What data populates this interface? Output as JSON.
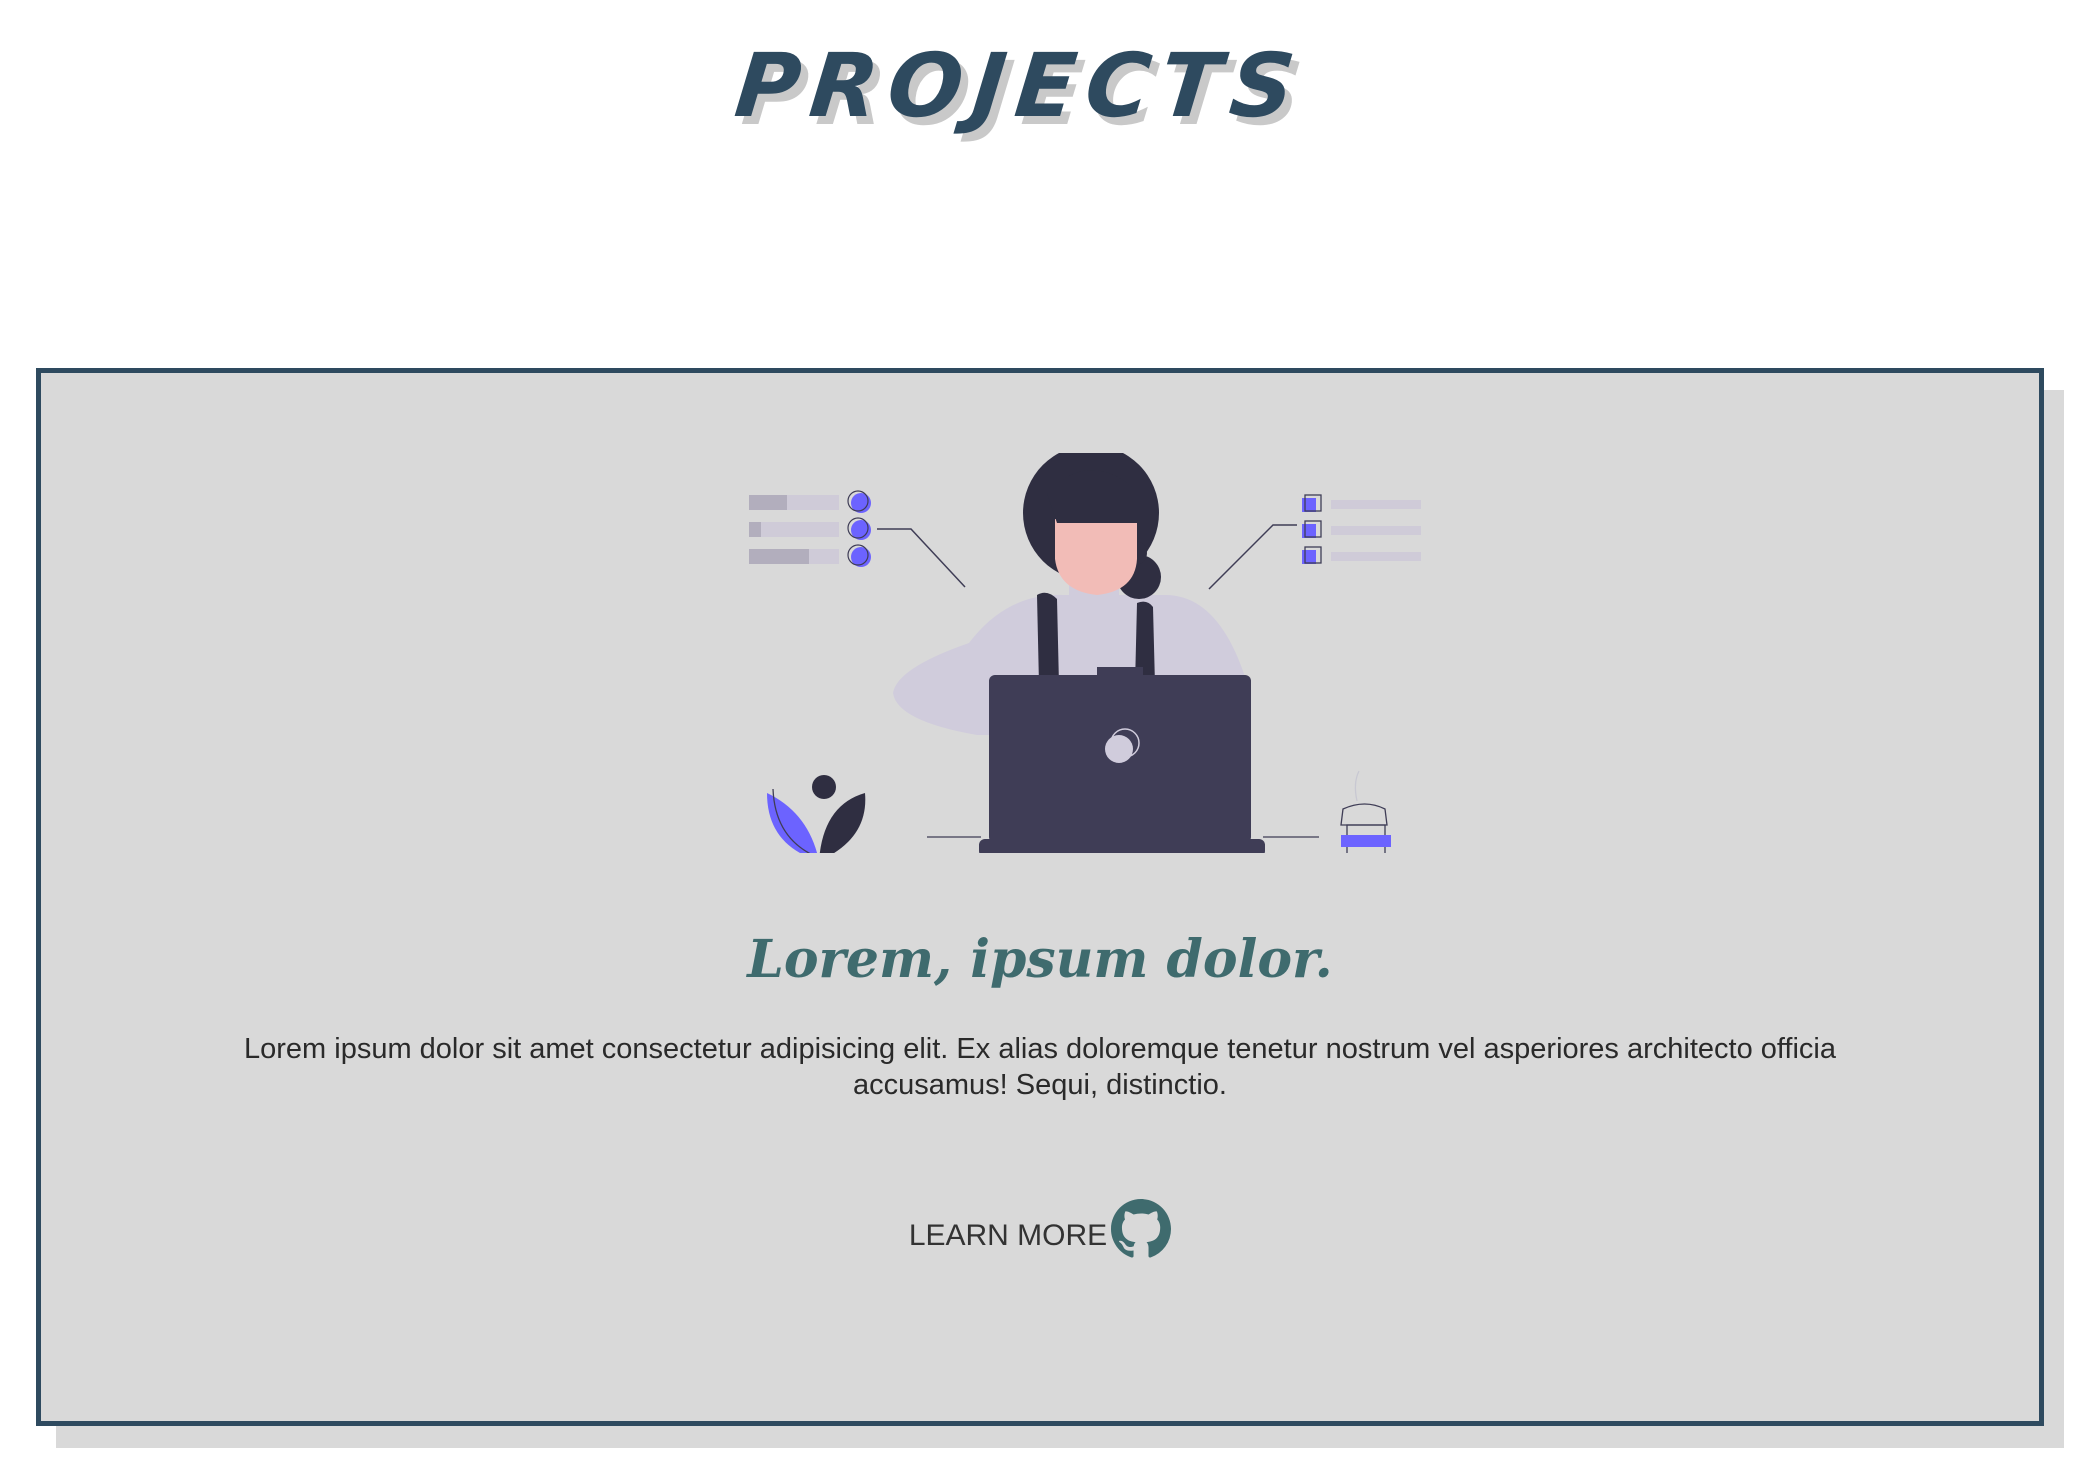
{
  "page": {
    "section_title": "PROJECTS"
  },
  "project_card": {
    "heading": "Lorem, ipsum dolor.",
    "description": "Lorem ipsum dolor sit amet consectetur adipisicing elit. Ex alias doloremque tenetur nostrum vel asperiores architecto officia accusamus! Sequi, distinctio.",
    "link_label": "LEARN MORE",
    "link_icon": "github-icon",
    "illustration_icon": "woman-at-laptop-illustration"
  },
  "colors": {
    "title": "#2e4a5f",
    "card_border": "#2e4a5f",
    "card_background": "#d9d9d9",
    "heading": "#3f6b6e",
    "accent": "#6c63ff",
    "dark": "#3f3d56"
  }
}
